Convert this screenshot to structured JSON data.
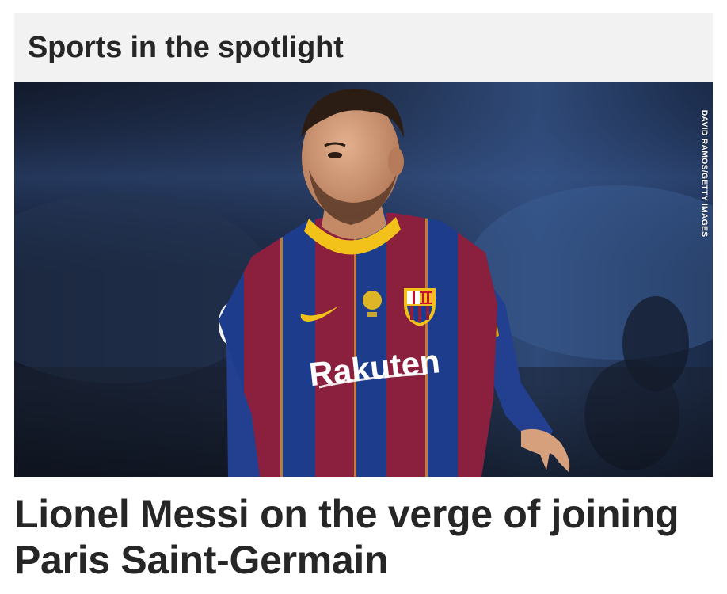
{
  "section": {
    "title": "Sports in the spotlight"
  },
  "media": {
    "photo_credit": "DAVID RAMOS/GETTY IMAGES",
    "jersey_sponsor": "Rakuten",
    "icons": [
      "nike-swoosh-icon",
      "club-crest-icon",
      "cup-badge-icon"
    ]
  },
  "article": {
    "headline": "Lionel Messi on the verge of joining Paris Saint-Germain"
  },
  "colors": {
    "header_bg": "#f2f2f2",
    "title_text": "#262626",
    "headline_text": "#262626",
    "jersey_blue": "#1e3c8c",
    "jersey_maroon": "#8a1f3e",
    "accent_yellow": "#f2c21b"
  }
}
